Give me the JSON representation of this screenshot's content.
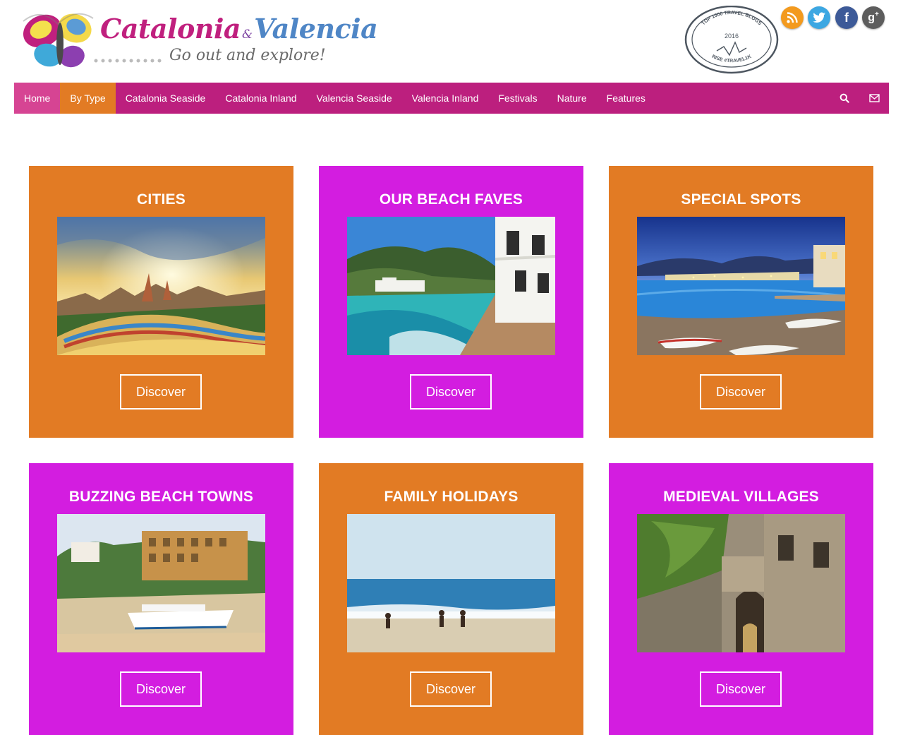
{
  "brand": {
    "name_part1": "Catalonia",
    "name_amp": "&",
    "name_part2": "Valencia",
    "tagline": "Go out and explore!"
  },
  "badge": {
    "top_text": "TOP 1000 TRAVEL BLOGS",
    "year": "2016",
    "bottom_text": "RISE #TRAVEL1K"
  },
  "social": [
    {
      "name": "rss",
      "icon": "rss-icon",
      "color": "#f39a1e"
    },
    {
      "name": "twitter",
      "icon": "twitter-icon",
      "color": "#3ca7e2"
    },
    {
      "name": "facebook",
      "icon": "facebook-icon",
      "color": "#3d5a98"
    },
    {
      "name": "google-plus",
      "icon": "google-plus-icon",
      "color": "#5d5d5d"
    }
  ],
  "nav": {
    "items": [
      {
        "label": "Home"
      },
      {
        "label": "By Type"
      },
      {
        "label": "Catalonia Seaside"
      },
      {
        "label": "Catalonia Inland"
      },
      {
        "label": "Valencia Seaside"
      },
      {
        "label": "Valencia Inland"
      },
      {
        "label": "Festivals"
      },
      {
        "label": "Nature"
      },
      {
        "label": "Features"
      }
    ],
    "active": "By Type",
    "icons": [
      "search-icon",
      "envelope-icon"
    ]
  },
  "colors": {
    "nav_bg": "#bc1f7e",
    "nav_home": "#d64493",
    "nav_active": "#e27b24",
    "tile_orange": "#e27b24",
    "tile_magenta": "#d31de0"
  },
  "tiles": [
    {
      "title": "CITIES",
      "button": "Discover",
      "color": "orange"
    },
    {
      "title": "OUR BEACH FAVES",
      "button": "Discover",
      "color": "magenta"
    },
    {
      "title": "SPECIAL SPOTS",
      "button": "Discover",
      "color": "orange"
    },
    {
      "title": "BUZZING BEACH TOWNS",
      "button": "Discover",
      "color": "magenta"
    },
    {
      "title": "FAMILY HOLIDAYS",
      "button": "Discover",
      "color": "orange"
    },
    {
      "title": "MEDIEVAL VILLAGES",
      "button": "Discover",
      "color": "magenta"
    }
  ]
}
